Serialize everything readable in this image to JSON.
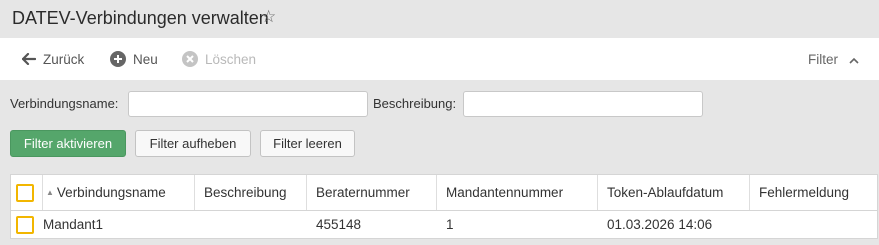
{
  "header": {
    "title": "DATEV-Verbindungen verwalten",
    "star_icon": "star-outline-icon"
  },
  "toolbar": {
    "back_label": "Zurück",
    "new_label": "Neu",
    "delete_label": "Löschen",
    "filter_label": "Filter"
  },
  "filter": {
    "name_label": "Verbindungsname:",
    "name_value": "",
    "description_label": "Beschreibung:",
    "description_value": "",
    "activate_label": "Filter aktivieren",
    "remove_label": "Filter aufheben",
    "clear_label": "Filter leeren"
  },
  "grid": {
    "columns": [
      "Verbindungsname",
      "Beschreibung",
      "Beraternummer",
      "Mandantennummer",
      "Token-Ablaufdatum",
      "Fehlermeldung"
    ],
    "rows": [
      [
        "Mandant1",
        "",
        "455148",
        "1",
        "01.03.2026 14:06",
        ""
      ]
    ]
  },
  "colors": {
    "primary_button": "#55a66b",
    "checkbox_border": "#f2b600",
    "background": "#e6e6e6",
    "toolbar_bg": "#ffffff"
  }
}
